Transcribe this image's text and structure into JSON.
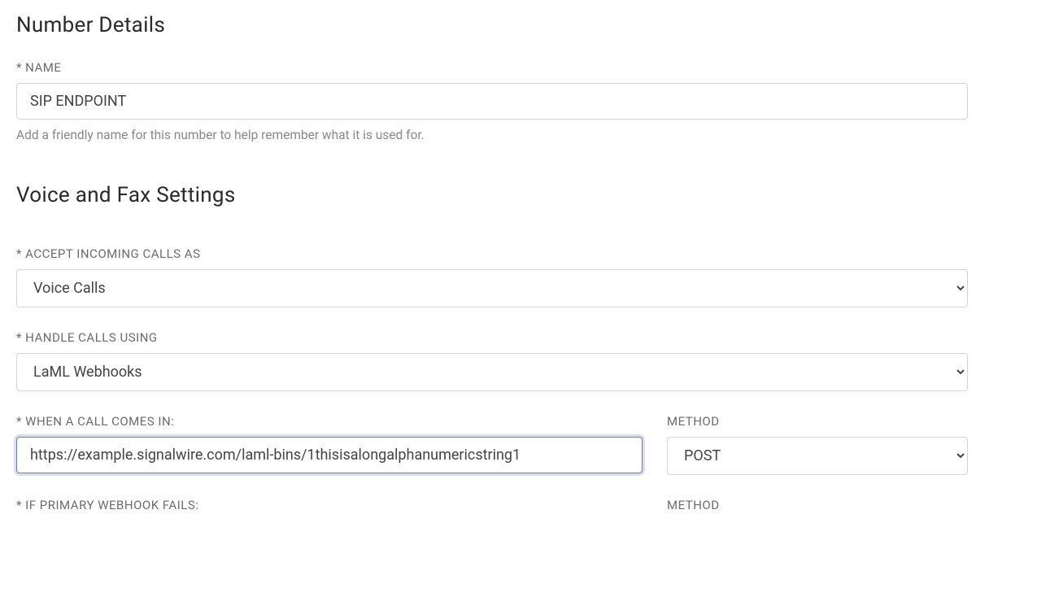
{
  "numberDetails": {
    "heading": "Number Details",
    "nameLabel": "* NAME",
    "nameValue": "SIP ENDPOINT",
    "nameHelp": "Add a friendly name for this number to help remember what it is used for."
  },
  "voiceFax": {
    "heading": "Voice and Fax Settings",
    "acceptLabel": "* ACCEPT INCOMING CALLS AS",
    "acceptValue": "Voice Calls",
    "handleLabel": "* HANDLE CALLS USING",
    "handleValue": "LaML Webhooks",
    "webhookLabel": "* WHEN A CALL COMES IN:",
    "webhookValue": "https://example.signalwire.com/laml-bins/1thisisalongalphanumericstring1",
    "methodLabel": "METHOD",
    "methodValue": "POST",
    "fallbackLabel": "* IF PRIMARY WEBHOOK FAILS:",
    "fallbackMethodLabel": "METHOD"
  }
}
